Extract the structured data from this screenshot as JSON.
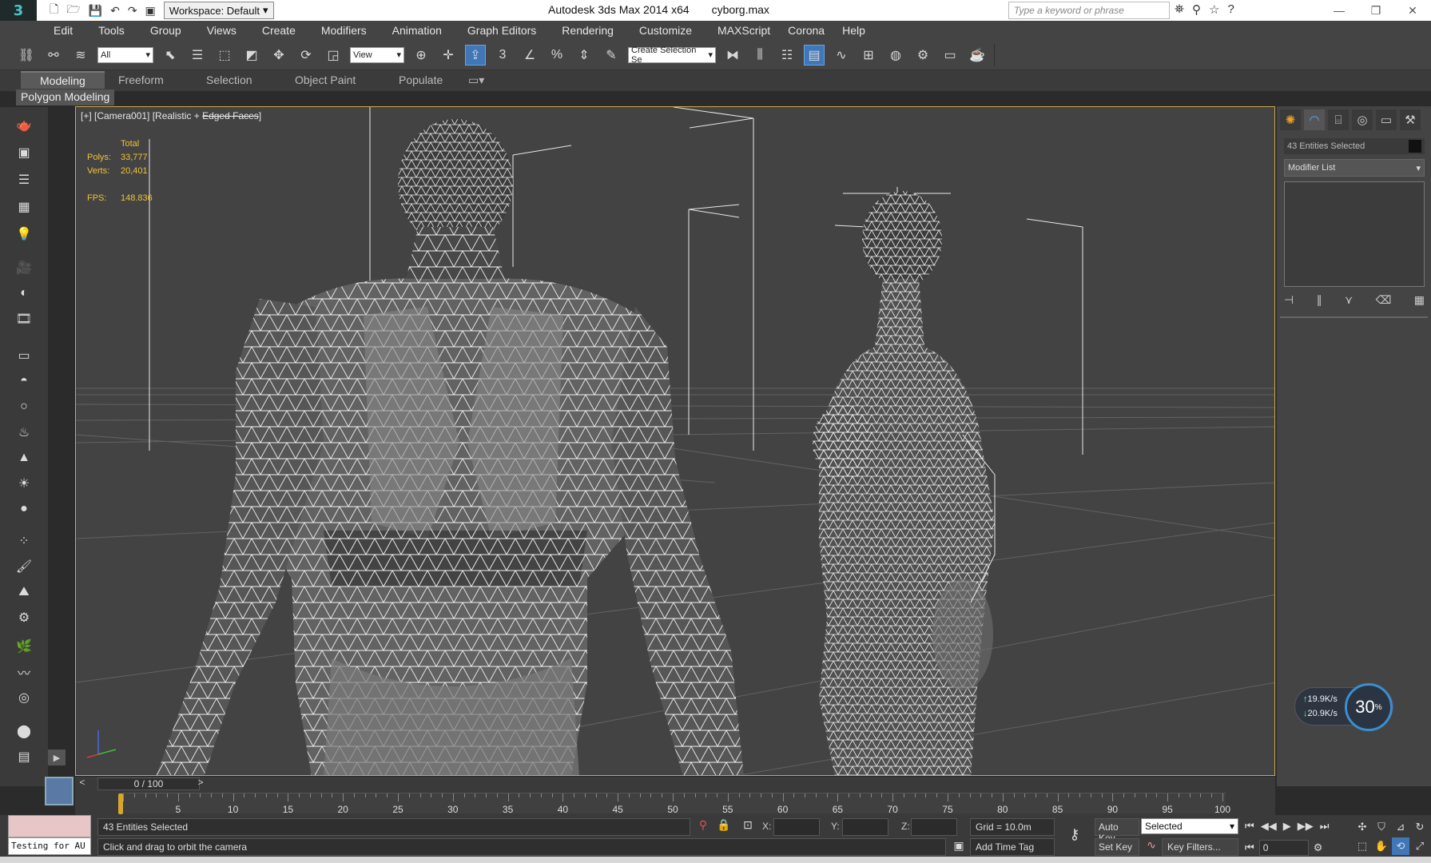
{
  "titlebar": {
    "workspace": "Workspace: Default",
    "app_title": "Autodesk 3ds Max  2014 x64",
    "filename": "cyborg.max",
    "search_placeholder": "Type a keyword or phrase"
  },
  "menu": {
    "items": [
      "Edit",
      "Tools",
      "Group",
      "Views",
      "Create",
      "Modifiers",
      "Animation",
      "Graph Editors",
      "Rendering",
      "Customize",
      "MAXScript",
      "Corona",
      "Help"
    ]
  },
  "toolbar": {
    "selection_filter": "All",
    "ref_coord": "View",
    "named_selection": "Create Selection Se",
    "snap_labels": [
      "3",
      "%"
    ]
  },
  "ribbon": {
    "tabs": [
      "Modeling",
      "Freeform",
      "Selection",
      "Object Paint",
      "Populate"
    ],
    "active_tab": "Modeling",
    "panel_label": "Polygon Modeling"
  },
  "viewport": {
    "label_prefix": "[+] [Camera001] [Realistic + ",
    "label_struck": "Edged Faces",
    "label_suffix": "]",
    "stats": {
      "total_label": "Total",
      "polys_label": "Polys:",
      "polys_value": "33,777",
      "verts_label": "Verts:",
      "verts_value": "20,401",
      "fps_label": "FPS:",
      "fps_value": "148.836"
    }
  },
  "command_panel": {
    "object_name": "43 Entities Selected",
    "modifier_list": "Modifier List"
  },
  "network_widget": {
    "upload": "19.9",
    "download": "20.9",
    "unit": "K/s",
    "percent": "30",
    "percent_unit": "%"
  },
  "timeline": {
    "frame_display": "0 / 100",
    "tick_labels": [
      "0",
      "5",
      "10",
      "15",
      "20",
      "25",
      "30",
      "35",
      "40",
      "45",
      "50",
      "55",
      "60",
      "65",
      "70",
      "75",
      "80",
      "85",
      "90",
      "95",
      "100"
    ]
  },
  "status": {
    "testing_text": "Testing for AU",
    "selection_text": "43 Entities Selected",
    "prompt_text": "Click and drag to orbit the camera",
    "x_label": "X:",
    "y_label": "Y:",
    "z_label": "Z:",
    "grid_text": "Grid = 10.0m",
    "add_time_tag": "Add Time Tag",
    "auto_key": "Auto Key",
    "set_key": "Set Key",
    "key_mode": "Selected",
    "key_filters": "Key Filters...",
    "current_frame": "0"
  },
  "colors": {
    "viewport_border": "#c9a94b",
    "stats_text": "#f0c23a",
    "active_button": "#3f77b8"
  }
}
